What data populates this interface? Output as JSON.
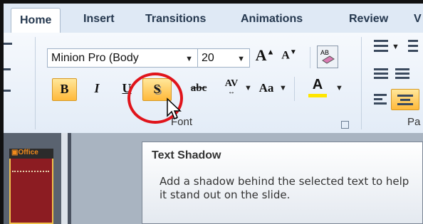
{
  "tabs": [
    "Home",
    "Insert",
    "Transitions",
    "Animations",
    "Review",
    "V"
  ],
  "font_group": {
    "font_name": "Minion Pro (Body",
    "font_size": "20",
    "grow_label": "A",
    "shrink_label": "A",
    "bold": "B",
    "italic": "I",
    "underline": "U",
    "shadow": "S",
    "strike": "abc",
    "spacing": "AV",
    "case": "Aa",
    "color": "A",
    "label": "Font"
  },
  "paragraph_group": {
    "label": "Pa"
  },
  "slide_thumb": {
    "text": "Office"
  },
  "tooltip": {
    "title": "Text Shadow",
    "body": "Add a shadow behind the selected text to help it stand out on the slide."
  },
  "colors": {
    "highlight": "#ffc84a",
    "ring": "#e0141b",
    "font_color_bar": "#ffe600"
  },
  "icons": [
    "clear-format-icon",
    "bullets-icon",
    "numbering-icon",
    "decrease-indent-icon",
    "increase-indent-icon",
    "align-left-icon",
    "align-center-icon",
    "dialog-launcher-icon",
    "pointer-cursor-icon"
  ]
}
